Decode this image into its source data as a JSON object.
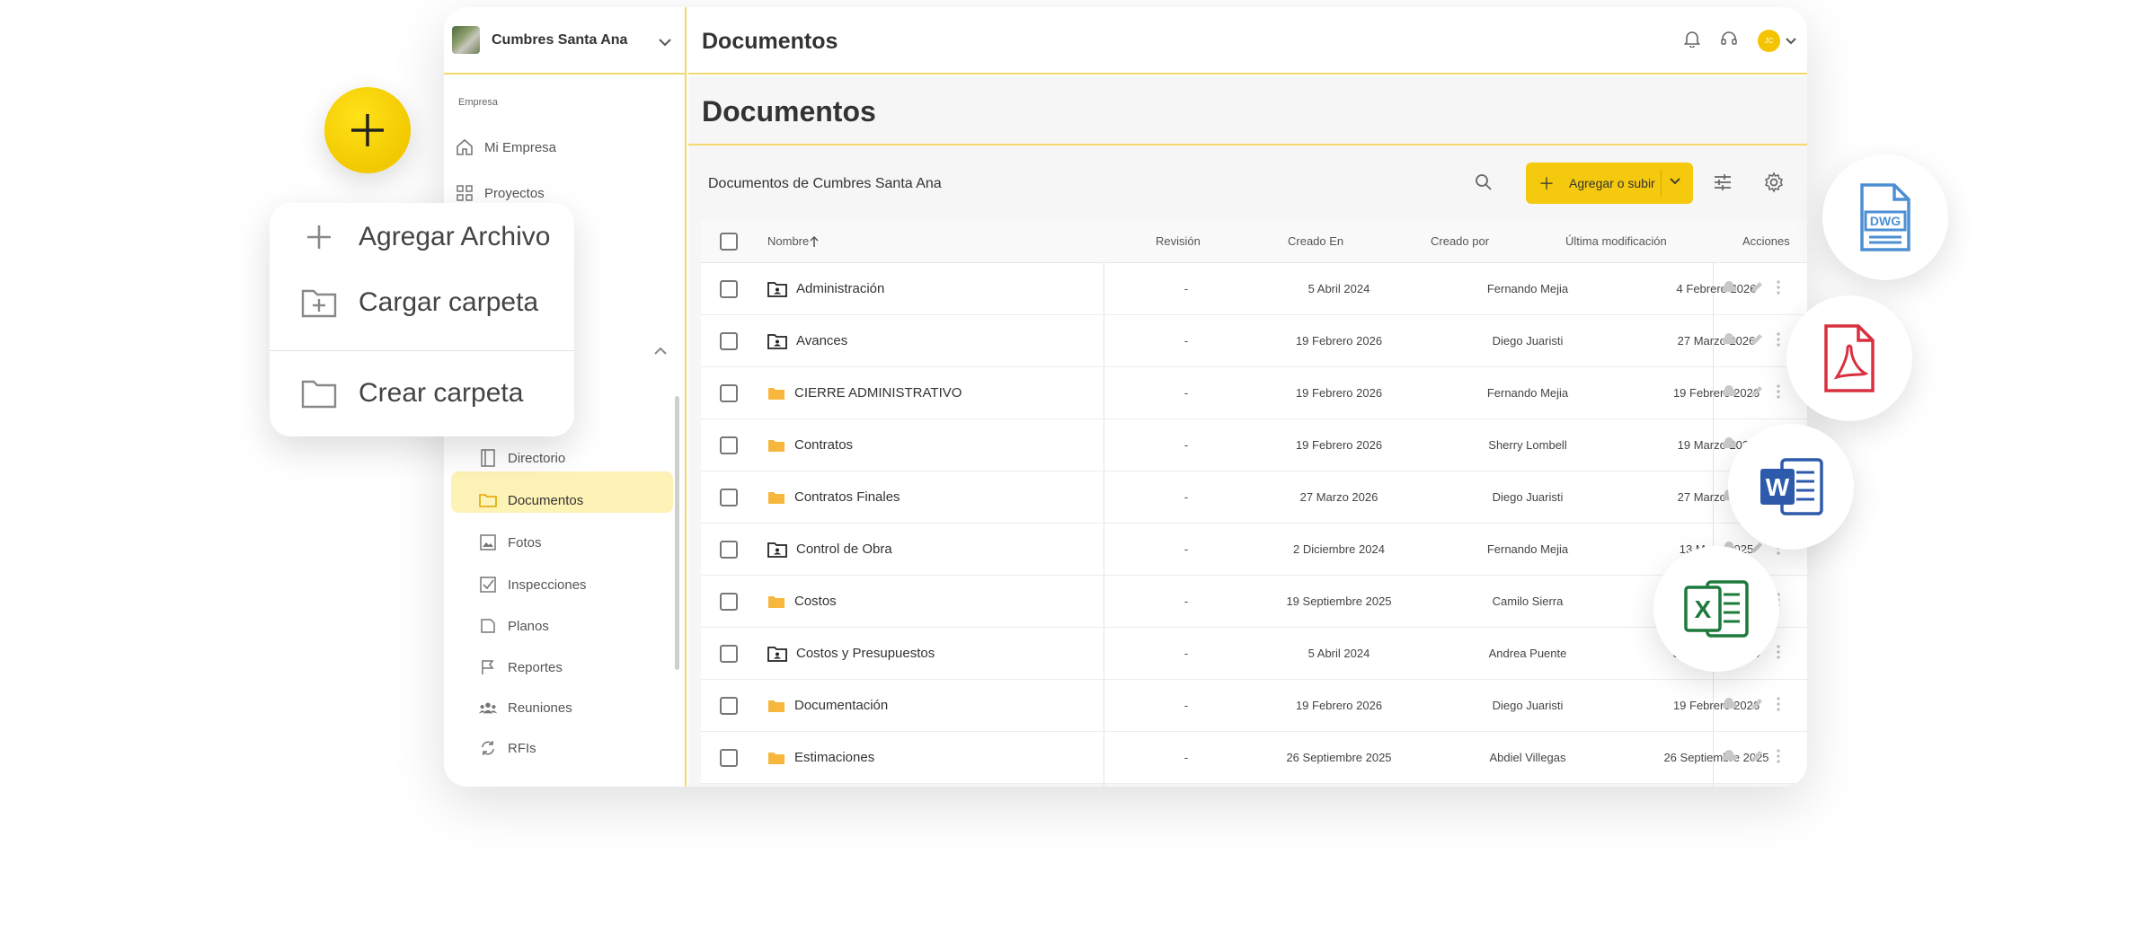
{
  "sidebar": {
    "project_name": "Cumbres Santa Ana",
    "section_label": "Empresa",
    "items": [
      {
        "label": "Mi Empresa",
        "icon": "home-icon"
      },
      {
        "label": "Proyectos",
        "icon": "grid-icon"
      },
      {
        "label": "Directorio",
        "icon": "book-icon"
      },
      {
        "label": "Documentos",
        "icon": "folder-icon"
      },
      {
        "label": "Fotos",
        "icon": "image-icon"
      },
      {
        "label": "Inspecciones",
        "icon": "checklist-icon"
      },
      {
        "label": "Planos",
        "icon": "plan-icon"
      },
      {
        "label": "Reportes",
        "icon": "flag-icon"
      },
      {
        "label": "Reuniones",
        "icon": "people-icon"
      },
      {
        "label": "RFIs",
        "icon": "sync-icon"
      }
    ]
  },
  "topbar": {
    "title": "Documentos",
    "avatar_initials": "JC"
  },
  "main": {
    "page_title": "Documentos",
    "list_label": "Documentos de Cumbres Santa Ana",
    "add_button_label": "Agregar o subir"
  },
  "table": {
    "headers": {
      "name": "Nombre",
      "revision": "Revisión",
      "created": "Creado En",
      "created_by": "Creado por",
      "modified": "Última modificación",
      "actions": "Acciones"
    },
    "rows": [
      {
        "name": "Administración",
        "type": "shared",
        "rev": "-",
        "created": "5 Abril 2024",
        "by": "Fernando Mejia",
        "modified": "4 Febrero 2026"
      },
      {
        "name": "Avances",
        "type": "shared",
        "rev": "-",
        "created": "19 Febrero 2026",
        "by": "Diego Juaristi",
        "modified": "27 Marzo 2026"
      },
      {
        "name": "CIERRE ADMINISTRATIVO",
        "type": "folder",
        "rev": "-",
        "created": "19 Febrero 2026",
        "by": "Fernando Mejia",
        "modified": "19 Febrero 2026"
      },
      {
        "name": "Contratos",
        "type": "folder",
        "rev": "-",
        "created": "19 Febrero 2026",
        "by": "Sherry Lombell",
        "modified": "19 Marzo 2026"
      },
      {
        "name": "Contratos Finales",
        "type": "folder",
        "rev": "-",
        "created": "27 Marzo 2026",
        "by": "Diego Juaristi",
        "modified": "27 Marzo 2026"
      },
      {
        "name": "Control de Obra",
        "type": "shared",
        "rev": "-",
        "created": "2 Diciembre 2024",
        "by": "Fernando Mejia",
        "modified": "13 Mayo 2025"
      },
      {
        "name": "Costos",
        "type": "folder",
        "rev": "-",
        "created": "19 Septiembre 2025",
        "by": "Camilo Sierra",
        "modified": "19 Septiembre 2"
      },
      {
        "name": "Costos y Presupuestos",
        "type": "shared",
        "rev": "-",
        "created": "5 Abril 2024",
        "by": "Andrea Puente",
        "modified": "31 Octubre 2024"
      },
      {
        "name": "Documentación",
        "type": "folder",
        "rev": "-",
        "created": "19 Febrero 2026",
        "by": "Diego Juaristi",
        "modified": "19 Febrero 2026"
      },
      {
        "name": "Estimaciones",
        "type": "folder",
        "rev": "-",
        "created": "26 Septiembre 2025",
        "by": "Abdiel Villegas",
        "modified": "26 Septiembre 2025"
      }
    ]
  },
  "add_menu": {
    "items": [
      {
        "label": "Agregar Archivo",
        "icon": "plus-icon"
      },
      {
        "label": "Cargar carpeta",
        "icon": "folder-upload-icon"
      },
      {
        "label": "Crear carpeta",
        "icon": "folder-icon"
      }
    ]
  },
  "file_badges": {
    "dwg": "DWG",
    "excel_letter": "X",
    "word_letter": "W"
  },
  "colors": {
    "accent_yellow": "#f4c90e",
    "divider_yellow": "#f3d86a",
    "active_bg": "#fdf3b7",
    "folder_orange": "#f6b73c",
    "pdf_red": "#d9303f",
    "word_blue": "#2e5aac",
    "excel_green": "#1e7a3c",
    "dwg_blue": "#4d8fd4"
  }
}
